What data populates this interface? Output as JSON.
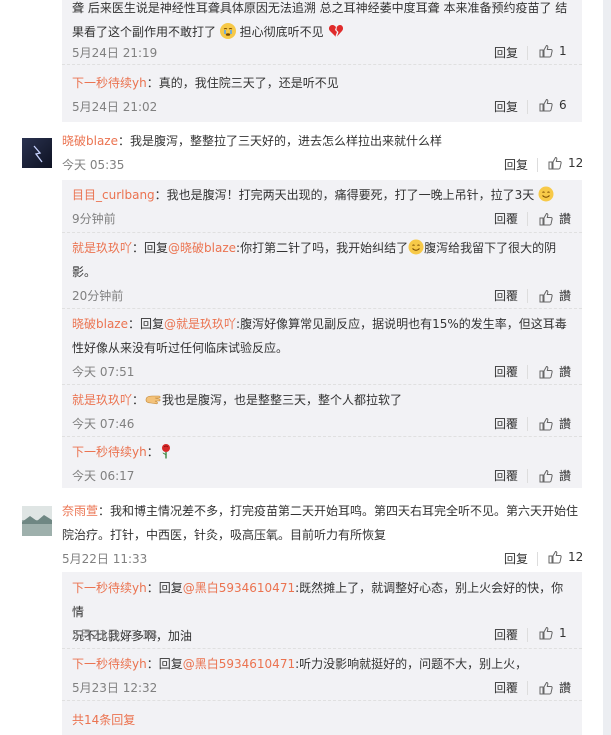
{
  "r1": {
    "line1": "聋 后来医生说是神经性耳聋具体原因无法追溯 总之耳神经萎中度耳聋 本来准备预约疫苗了 结",
    "line2": "果看了这个副作用不敢打了",
    "line2b": "担心彻底听不见",
    "time": "5月24日 21:19",
    "reply": "回复",
    "likes": "1"
  },
  "r2": {
    "user": "下一秒待续yh",
    "text": "：真的，我住院三天了，还是听不见",
    "time": "5月24日 21:02",
    "reply": "回复",
    "likes": "6"
  },
  "c1": {
    "user": "晓破blaze",
    "text": "：我是腹泻，整整拉了三天好的，进去怎么样拉出来就什么样",
    "time": "今天 05:35",
    "reply": "回复",
    "likes": "12"
  },
  "c1r1": {
    "user": "目目_curlbang",
    "text": "：我也是腹泻！打完两天出现的，痛得要死，打了一晚上吊针，拉了3天",
    "time": "9分钟前",
    "reply": "回覆",
    "likes": "讚"
  },
  "c1r2": {
    "user": "就是玖玖吖",
    "pre": "：回复",
    "mention": "@晓破blaze",
    "text": ":你打第二针了吗，我开始纠结了",
    "text2": "腹泻给我留下了很大的阴",
    "line2": "影。",
    "time": "20分钟前",
    "reply": "回覆",
    "likes": "讚"
  },
  "c1r3": {
    "user": "晓破blaze",
    "pre": "：回复",
    "mention": "@就是玖玖吖",
    "text": ":腹泻好像算常见副反应，据说明也有15%的发生率，但这耳毒",
    "line2": "性好像从来没有听过任何临床试验反应。",
    "time": "今天 07:51",
    "reply": "回覆",
    "likes": "讚"
  },
  "c1r4": {
    "user": "就是玖玖吖",
    "text": "我也是腹泻，也是整整三天，整个人都拉软了",
    "time": "今天 07:46",
    "reply": "回覆",
    "likes": "讚"
  },
  "c1r5": {
    "user": "下一秒待续yh",
    "time": "今天 06:17",
    "reply": "回覆",
    "likes": "讚"
  },
  "c2": {
    "user": "奈雨萱",
    "text": "：我和博主情况差不多，打完疫苗第二天开始耳鸣。第四天右耳完全听不见。第六天开始住",
    "line2": "院治疗。打针，中西医，针灸，吸高压氧。目前听力有所恢复",
    "time": "5月22日 11:33",
    "reply": "回复",
    "likes": "12"
  },
  "c2r1": {
    "user": "下一秒待续yh",
    "pre": "：回复",
    "mention": "@黑白5934610471",
    "text": ":既然摊上了，就调整好心态，别上火会好的快，你情",
    "line2": "况不比我好多啊，加油",
    "time": "5月23日 13:38",
    "reply": "回覆",
    "likes": "1"
  },
  "c2r2": {
    "user": "下一秒待续yh",
    "pre": "：回复",
    "mention": "@黑白5934610471",
    "text": ":听力没影响就挺好的，问题不大，别上火，",
    "time": "5月23日 12:32",
    "reply": "回覆",
    "likes": "讚"
  },
  "more": "共14条回复",
  "colors": {
    "accent": "#eb7350",
    "panel": "#f2f2f5",
    "meta": "#808080"
  },
  "icons": [
    "thumb-up-icon",
    "crying-emoji-icon",
    "broken-heart-icon",
    "smile-emoji-icon",
    "hand-emoji-icon",
    "rose-icon",
    "user-avatar"
  ]
}
